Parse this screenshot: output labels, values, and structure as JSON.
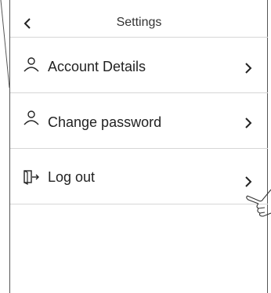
{
  "header": {
    "title": "Settings",
    "back_icon": "chevron-left-icon"
  },
  "menu": {
    "items": [
      {
        "label": "Account Details",
        "icon": "user-icon",
        "trailing_icon": "chevron-right-icon"
      },
      {
        "label": "Change password",
        "icon": "user-icon",
        "trailing_icon": "chevron-right-icon"
      },
      {
        "label": "Log out",
        "icon": "logout-icon",
        "trailing_icon": "chevron-right-icon"
      }
    ]
  },
  "colors": {
    "text": "#222222",
    "divider": "#d6d6d6",
    "frame": "#555555"
  }
}
